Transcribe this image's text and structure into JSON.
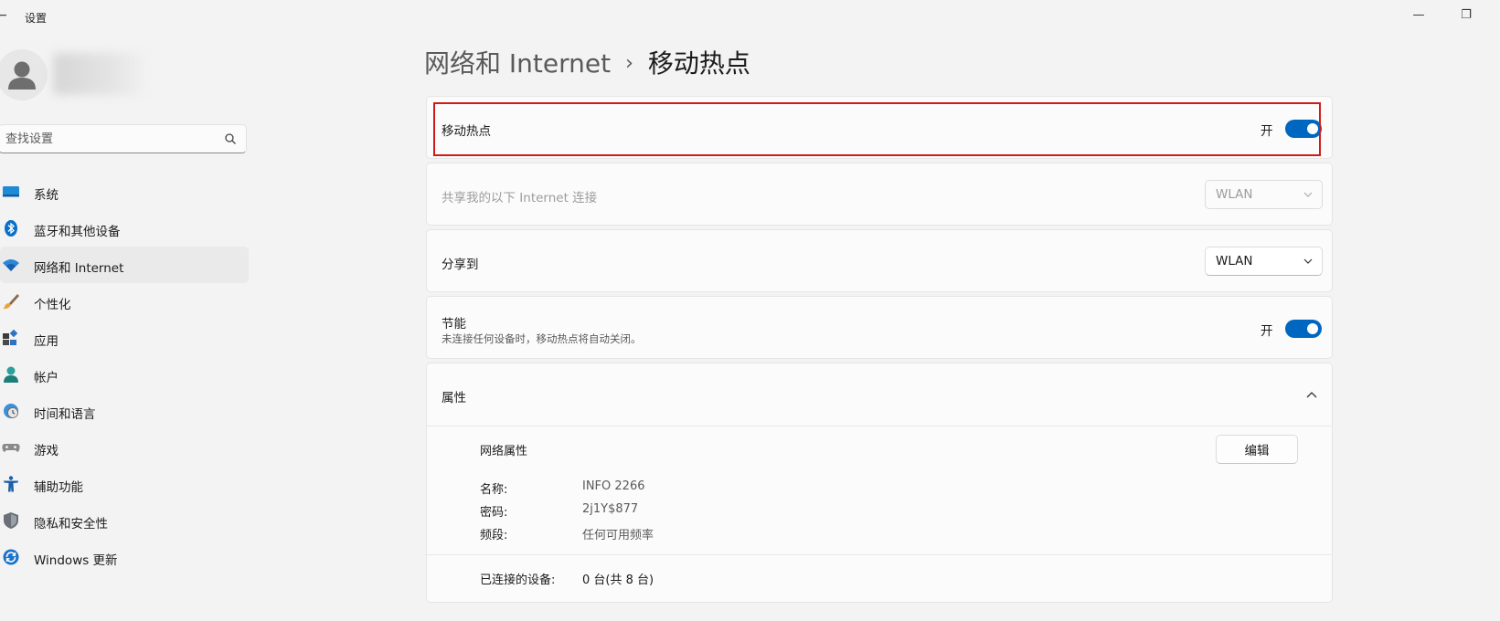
{
  "window": {
    "title": "设置",
    "back_glyph": "←",
    "minimize_glyph": "—",
    "restore_glyph": "❐"
  },
  "search": {
    "placeholder": "查找设置"
  },
  "sidebar": {
    "items": [
      {
        "label": "系统",
        "icon": "monitor-icon",
        "active": false
      },
      {
        "label": "蓝牙和其他设备",
        "icon": "bluetooth-icon",
        "active": false
      },
      {
        "label": "网络和 Internet",
        "icon": "wifi-icon",
        "active": true
      },
      {
        "label": "个性化",
        "icon": "brush-icon",
        "active": false
      },
      {
        "label": "应用",
        "icon": "apps-icon",
        "active": false
      },
      {
        "label": "帐户",
        "icon": "person-icon",
        "active": false
      },
      {
        "label": "时间和语言",
        "icon": "clock-globe-icon",
        "active": false
      },
      {
        "label": "游戏",
        "icon": "gamepad-icon",
        "active": false
      },
      {
        "label": "辅助功能",
        "icon": "accessibility-icon",
        "active": false
      },
      {
        "label": "隐私和安全性",
        "icon": "shield-icon",
        "active": false
      },
      {
        "label": "Windows 更新",
        "icon": "update-icon",
        "active": false
      }
    ]
  },
  "breadcrumb": {
    "parent": "网络和 Internet",
    "separator": "›",
    "current": "移动热点"
  },
  "hotspot": {
    "label": "移动热点",
    "state": "开",
    "on": true
  },
  "share_from": {
    "label": "共享我的以下 Internet 连接",
    "value": "WLAN",
    "enabled": false
  },
  "share_to": {
    "label": "分享到",
    "value": "WLAN",
    "enabled": true
  },
  "power_saving": {
    "label": "节能",
    "description": "未连接任何设备时，移动热点将自动关闭。",
    "state": "开",
    "on": true
  },
  "properties": {
    "header": "属性",
    "section_label": "网络属性",
    "edit_button": "编辑",
    "fields": [
      {
        "label": "名称:",
        "value": "INFO 2266"
      },
      {
        "label": "密码:",
        "value": "2j1Y$877"
      },
      {
        "label": "频段:",
        "value": "任何可用频率"
      }
    ],
    "connected": {
      "label": "已连接的设备:",
      "value": "0 台(共 8 台)"
    }
  },
  "colors": {
    "accent": "#0067c0",
    "highlight": "#d11a1a",
    "background": "#f3f3f3",
    "card": "#fbfbfb"
  }
}
